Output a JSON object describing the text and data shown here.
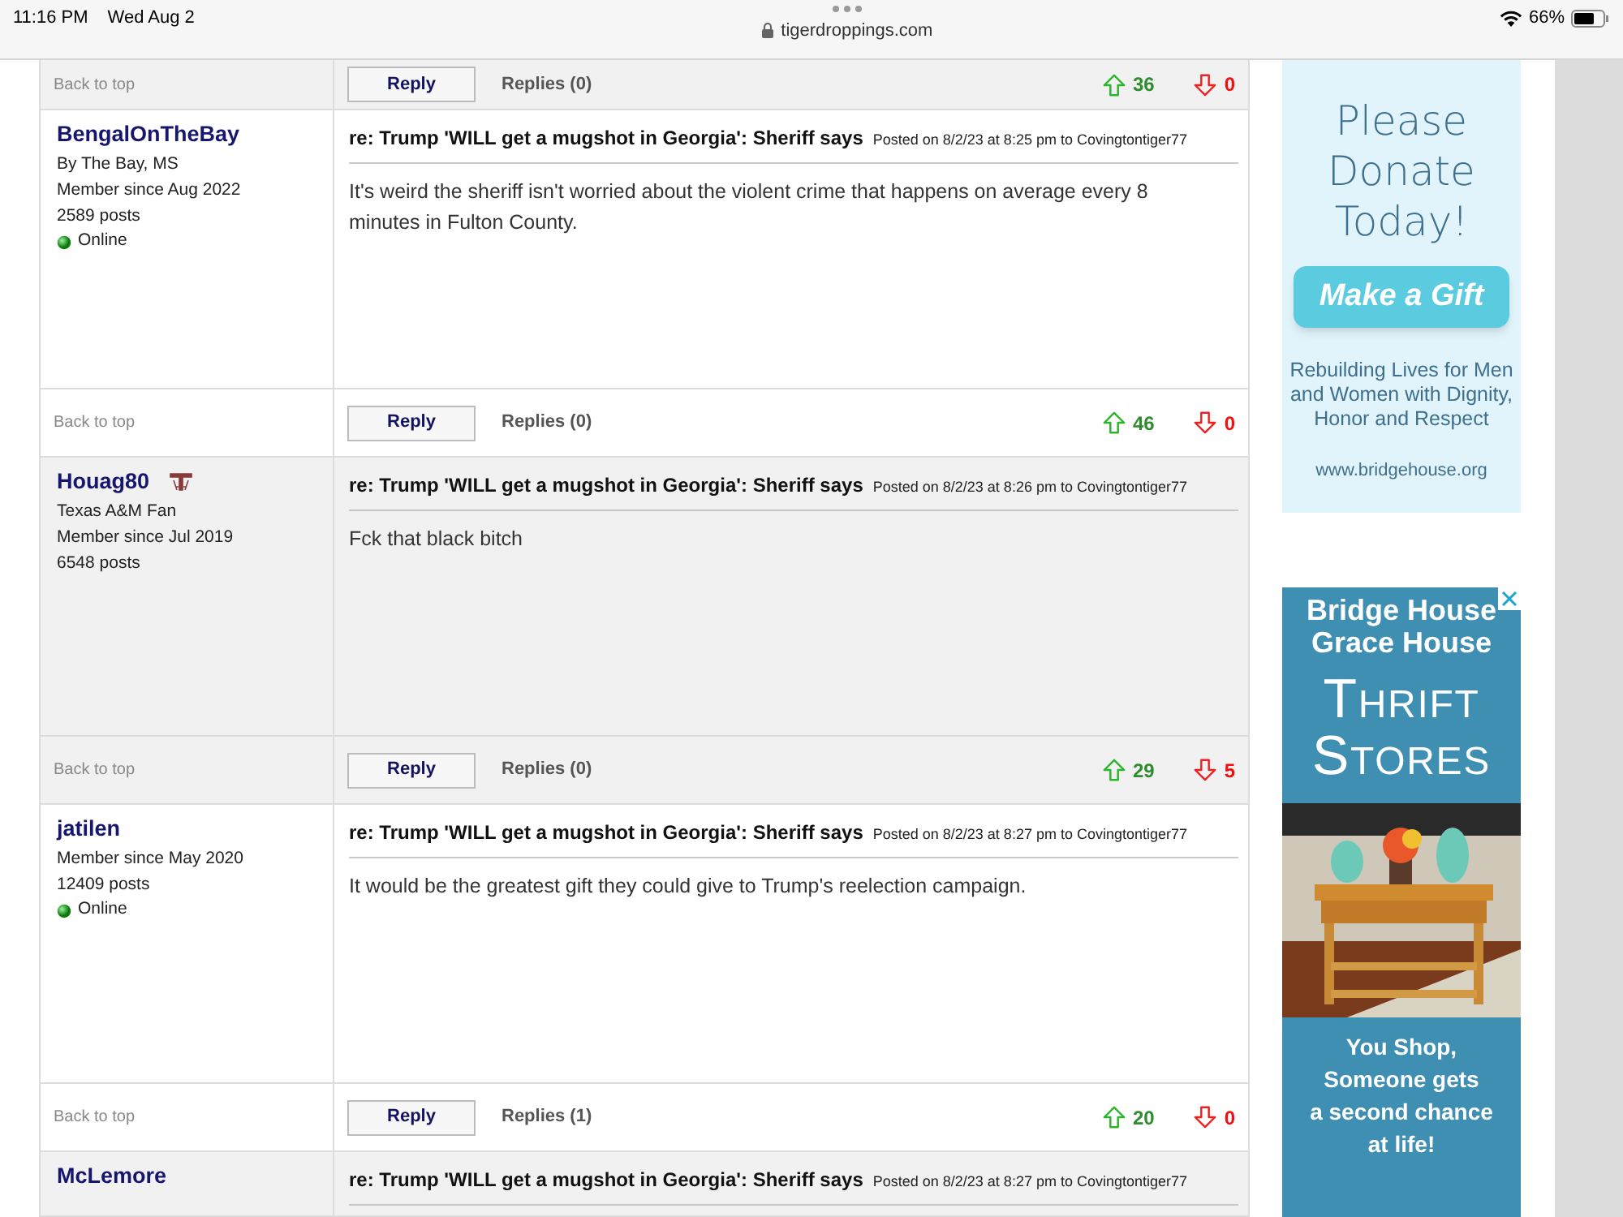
{
  "status_bar": {
    "time": "11:16 PM",
    "date": "Wed Aug 2",
    "url": "tigerdroppings.com",
    "battery": "66%"
  },
  "top_footer": {
    "back_to_top": "Back to top",
    "reply": "Reply",
    "replies": "Replies (0)",
    "up": "36",
    "down": "0"
  },
  "posts": [
    {
      "author": "BengalOnTheBay",
      "team_logo": false,
      "meta": [
        "By The Bay, MS",
        "Member since Aug 2022",
        "2589 posts"
      ],
      "online": true,
      "online_label": "Online",
      "title": "re: Trump 'WILL get a mugshot in Georgia': Sheriff says",
      "posted": "Posted on 8/2/23 at 8:25 pm to Covingtontiger77",
      "body": "It's weird the sheriff isn't worried about the violent crime that happens on average every 8 minutes in Fulton County.",
      "shaded": false,
      "footer": {
        "back_to_top": "Back to top",
        "reply": "Reply",
        "replies": "Replies (0)",
        "up": "46",
        "down": "0"
      }
    },
    {
      "author": "Houag80",
      "team_logo": true,
      "meta": [
        "Texas A&M Fan",
        "Member since Jul 2019",
        "6548 posts"
      ],
      "online": false,
      "title": "re: Trump 'WILL get a mugshot in Georgia': Sheriff says",
      "posted": "Posted on 8/2/23 at 8:26 pm to Covingtontiger77",
      "body": "Fck that black bitch",
      "shaded": true,
      "footer": {
        "back_to_top": "Back to top",
        "reply": "Reply",
        "replies": "Replies (0)",
        "up": "29",
        "down": "5"
      }
    },
    {
      "author": "jatilen",
      "team_logo": false,
      "meta": [
        "Member since May 2020",
        "12409 posts"
      ],
      "online": true,
      "online_label": "Online",
      "title": "re: Trump 'WILL get a mugshot in Georgia': Sheriff says",
      "posted": "Posted on 8/2/23 at 8:27 pm to Covingtontiger77",
      "body": "It would be the greatest gift they could give to Trump's reelection campaign.",
      "shaded": false,
      "footer": {
        "back_to_top": "Back to top",
        "reply": "Reply",
        "replies": "Replies (1)",
        "up": "20",
        "down": "0"
      }
    },
    {
      "author": "McLemore",
      "title": "re: Trump 'WILL get a mugshot in Georgia': Sheriff says",
      "posted": "Posted on 8/2/23 at 8:27 pm to Covingtontiger77",
      "shaded": true
    }
  ],
  "donate_ad": {
    "headline": [
      "Please",
      "Donate",
      "Today!"
    ],
    "button": "Make a Gift",
    "tagline": "Rebuilding Lives for Men and Women with Dignity, Honor and Respect",
    "url": "www.bridgehouse.org"
  },
  "thrift_ad": {
    "names": [
      "Bridge House",
      "Grace House"
    ],
    "headline": [
      "Thrift",
      "Stores"
    ],
    "tagline": [
      "You Shop,",
      "Someone gets",
      "a second chance",
      "at life!"
    ]
  }
}
